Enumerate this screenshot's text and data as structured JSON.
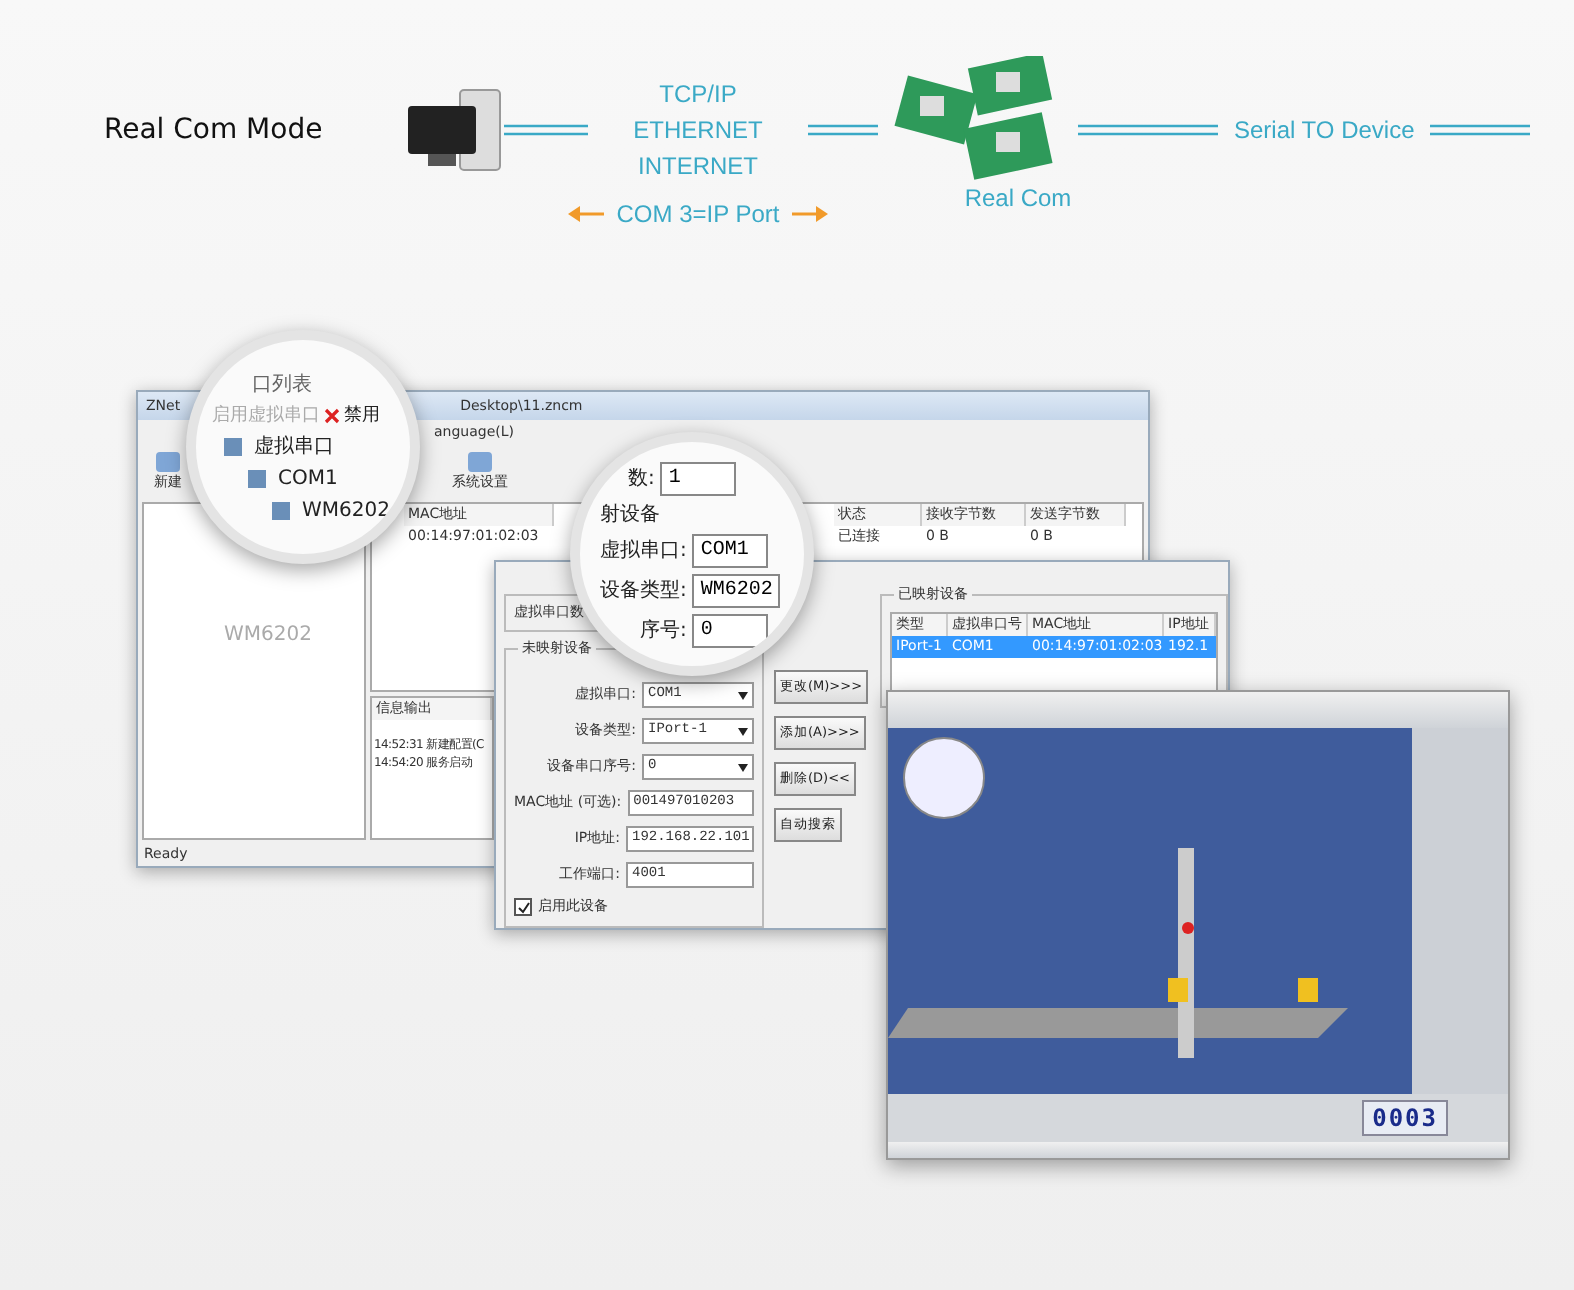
{
  "diagram": {
    "title": "Real Com Mode",
    "link_labels": [
      "TCP/IP",
      "ETHERNET",
      "INTERNET"
    ],
    "port_mapping": "COM 3=IP Port",
    "module_label": "Real Com",
    "serial_label": "Serial TO Device"
  },
  "manager_window": {
    "title": "ZNet",
    "path": "Desktop\\11.zncm",
    "menu": "anguage(L)",
    "toolbar": [
      "新建",
      "系统设置"
    ],
    "columns": [
      "MAC地址",
      "状态",
      "接收字节数",
      "发送字节数"
    ],
    "rows": [
      {
        "cells": [
          "00:14:97:01:02:03",
          "已连接",
          "0 B",
          "0 B"
        ]
      }
    ],
    "tree_label": "WM6202",
    "log_title": "信息输出",
    "log": [
      "14:52:31 新建配置(C",
      "14:54:20 服务启动"
    ],
    "status": "Ready"
  },
  "magnifier_tree": {
    "title": "口列表",
    "actions": [
      "启用虚拟串口",
      "禁用"
    ],
    "tree": [
      {
        "label": "虚拟串口",
        "children": [
          {
            "label": "COM1",
            "children": [
              {
                "label": "WM6202"
              }
            ]
          }
        ]
      }
    ]
  },
  "magnifier_form": {
    "count_label": "数:",
    "count_value": "1",
    "section": "射设备",
    "fields": [
      {
        "label": "虚拟串口:",
        "value": "COM1"
      },
      {
        "label": "设备类型:",
        "value": "WM6202"
      },
      {
        "label": "序号:",
        "value": "0"
      }
    ]
  },
  "mapping_dialog": {
    "count_label": "虚拟串口数",
    "group": "未映射设备",
    "fields": [
      {
        "label": "虚拟串口:",
        "value": "COM1",
        "kind": "select"
      },
      {
        "label": "设备类型:",
        "value": "IPort-1",
        "kind": "select"
      },
      {
        "label": "设备串口序号:",
        "value": "0",
        "kind": "select"
      },
      {
        "label": "MAC地址 (可选):",
        "value": "001497010203",
        "kind": "text"
      },
      {
        "label": "IP地址:",
        "value": "192.168.22.101",
        "kind": "text"
      },
      {
        "label": "工作端口:",
        "value": "4001",
        "kind": "text"
      }
    ],
    "enable": {
      "label": "启用此设备",
      "checked": true
    },
    "buttons": [
      "更改(M)>>>",
      "添加(A)>>>",
      "删除(D)<<",
      "自动搜索"
    ],
    "mapped_title": "已映射设备",
    "mapped_columns": [
      "类型",
      "虚拟串口号",
      "MAC地址",
      "IP地址"
    ],
    "mapped_rows": [
      {
        "cells": [
          "IPort-1",
          "COM1",
          "00:14:97:01:02:03",
          "192.1"
        ],
        "selected": true
      }
    ]
  },
  "scada": {
    "counter": "0003"
  }
}
